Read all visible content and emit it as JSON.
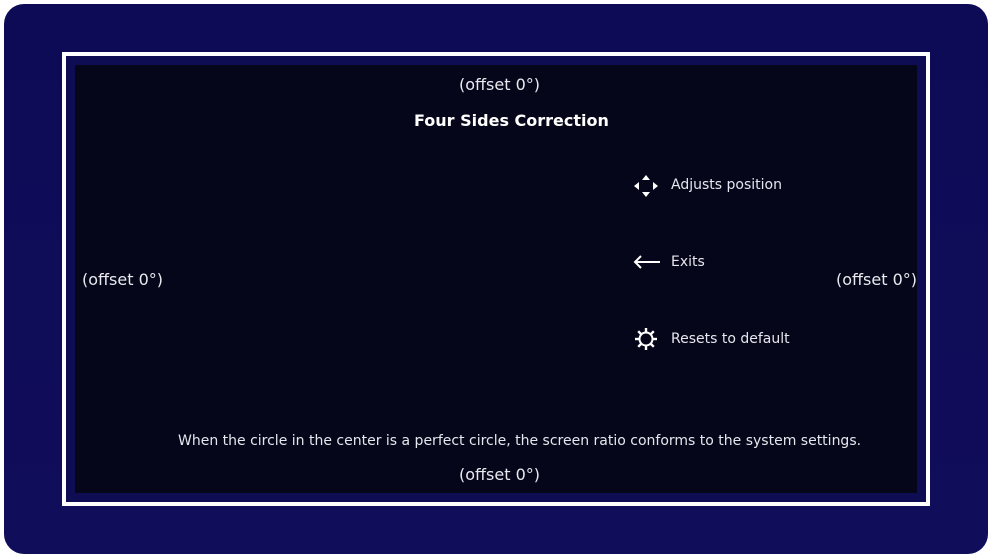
{
  "screen": {
    "title": "Four Sides Correction",
    "offsets": {
      "top": "(offset 0°)",
      "left": "(offset 0°)",
      "right": "(offset 0°)",
      "bottom": "(offset 0°)"
    },
    "legend": [
      {
        "icon": "four-direction-arrows-icon",
        "label": "Adjusts position"
      },
      {
        "icon": "left-arrow-icon",
        "label": "Exits"
      },
      {
        "icon": "gear-icon",
        "label": "Resets to default"
      }
    ],
    "note": "When the circle in the center is a perfect circle, the screen ratio conforms to the system settings."
  }
}
